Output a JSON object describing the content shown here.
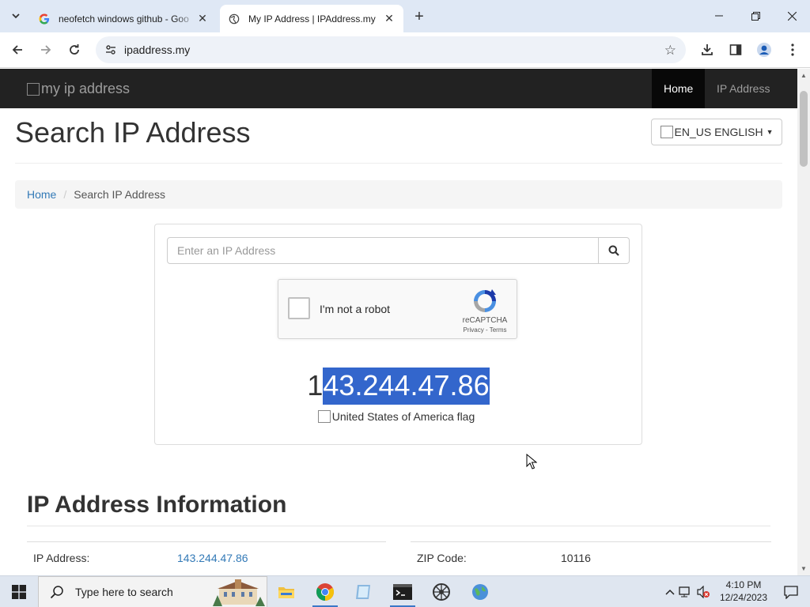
{
  "browser": {
    "tabs": [
      {
        "title": "neofetch windows github - Goo",
        "active": false,
        "icon": "google-icon"
      },
      {
        "title": "My IP Address | IPAddress.my",
        "active": true,
        "icon": "globe-icon"
      }
    ],
    "url": "ipaddress.my"
  },
  "site": {
    "logo_alt": "my ip address",
    "nav": [
      {
        "label": "Home",
        "active": true
      },
      {
        "label": "IP Address",
        "active": false
      }
    ],
    "page_title": "Search IP Address",
    "language_button": "EN_US ENGLISH",
    "breadcrumb": {
      "home": "Home",
      "current": "Search IP Address"
    }
  },
  "search": {
    "placeholder": "Enter an IP Address",
    "recaptcha_label": "I'm not a robot",
    "recaptcha_brand": "reCAPTCHA",
    "recaptcha_terms": "Privacy - Terms"
  },
  "result": {
    "ip_first_char": "1",
    "ip_selected": "43.244.47.86",
    "flag_alt": "United States of America flag"
  },
  "info": {
    "title": "IP Address Information",
    "rows": [
      {
        "label": "IP Address:",
        "value": "143.244.47.86"
      },
      {
        "label": "ZIP Code:",
        "value": "10116"
      }
    ]
  },
  "taskbar": {
    "search_placeholder": "Type here to search",
    "time": "4:10 PM",
    "date": "12/24/2023"
  },
  "colors": {
    "accent_link": "#337ab7",
    "navbar_bg": "#222222",
    "selection": "#3366cc"
  }
}
